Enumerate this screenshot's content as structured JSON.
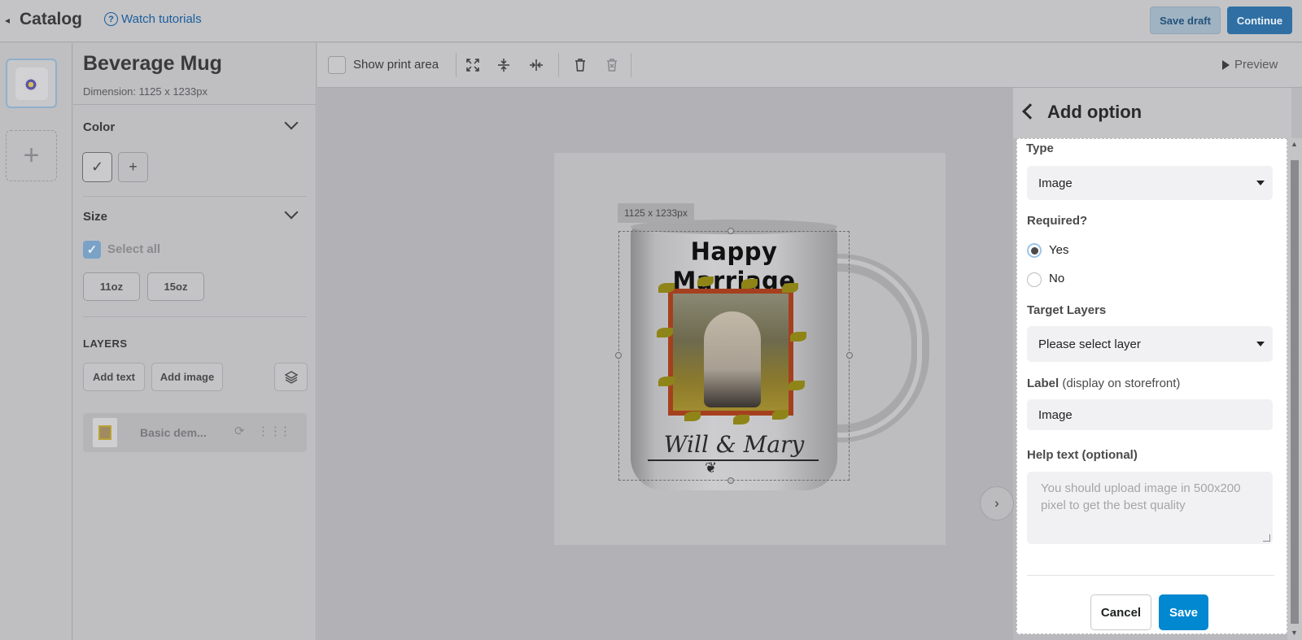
{
  "topbar": {
    "back_label": "Catalog",
    "tutorials_label": "Watch tutorials",
    "save_draft_label": "Save draft",
    "continue_label": "Continue"
  },
  "product": {
    "title": "Beverage Mug",
    "dimension": "Dimension: 1125 x 1233px"
  },
  "color_section": {
    "label": "Color"
  },
  "size_section": {
    "label": "Size",
    "select_all_label": "Select all",
    "select_all_checked": true,
    "sizes": [
      "11oz",
      "15oz"
    ]
  },
  "layers_section": {
    "label": "LAYERS",
    "add_text_label": "Add text",
    "add_image_label": "Add image",
    "items": [
      {
        "name": "Basic dem..."
      }
    ]
  },
  "toolbar": {
    "show_print_area_label": "Show print area",
    "show_print_area_checked": false,
    "preview_label": "Preview"
  },
  "canvas": {
    "selection_size_label": "1125 x 1233px",
    "mug_text_top": "Happy Marriage",
    "mug_text_bottom": "Will & Mary"
  },
  "add_option": {
    "title": "Add option",
    "type_label": "Type",
    "type_value": "Image",
    "required_label": "Required?",
    "required_yes": "Yes",
    "required_no": "No",
    "required_value": "Yes",
    "target_layers_label": "Target Layers",
    "target_layers_placeholder": "Please select layer",
    "label_label": "Label",
    "label_hint": "(display on storefront)",
    "label_value": "Image",
    "help_text_label": "Help text (optional)",
    "help_text_placeholder": "You should upload image in 500x200 pixel to get the best quality",
    "cancel_label": "Cancel",
    "save_label": "Save"
  },
  "colors": {
    "primary_blue": "#0288d1",
    "link_blue": "#1a5e9e",
    "overlay_gray": "#b9b9bd"
  }
}
